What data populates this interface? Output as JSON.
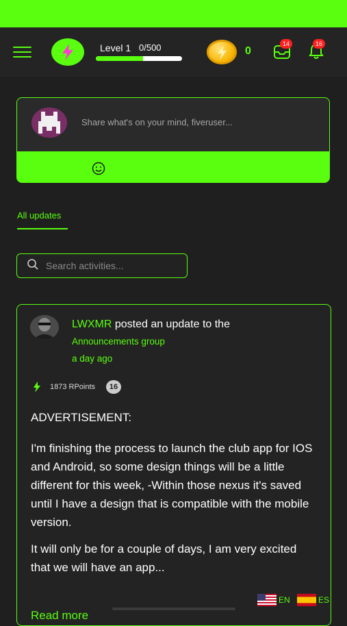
{
  "header": {
    "level_label": "Level 1",
    "level_progress_text": "0/500",
    "level_progress_fraction": 0.55,
    "coins": "0",
    "messages_badge": "14",
    "notifications_badge": "16"
  },
  "composer": {
    "placeholder": "Share what's on your mind, fiveruser..."
  },
  "tabs": {
    "all_updates": "All updates"
  },
  "search": {
    "placeholder": "Search activities..."
  },
  "post": {
    "author": "LWXMR",
    "action": "posted an update to the",
    "group": "Announcements group",
    "time": "a day ago",
    "points": "1873 RPoints",
    "rank_badge": "16",
    "title": "ADVERTISEMENT:",
    "body_p1": "I'm finishing the process to launch the club app for IOS and Android, so some design things will be a little different for this week, -Within those nexus it's saved until I have a design that is compatible with the mobile version.",
    "body_p2": "It will only be for a couple of days, I am very excited that we will have an app...",
    "read_more": "Read more"
  },
  "languages": [
    {
      "code": "EN"
    },
    {
      "code": "ES"
    }
  ],
  "colors": {
    "accent": "#59ff0f",
    "background": "#1f1f1f",
    "badge": "#ff1f1f"
  }
}
